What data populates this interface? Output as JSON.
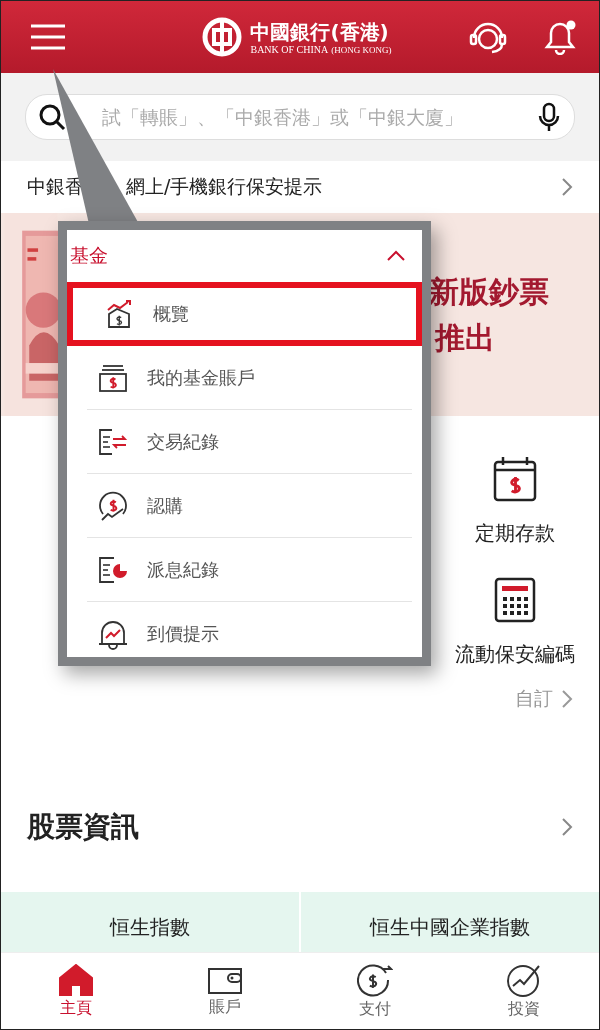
{
  "header": {
    "logo_title": "中國銀行(香港)",
    "logo_subtitle": "BANK OF CHINA",
    "logo_region": "(HONG KONG)",
    "notification_dot": true
  },
  "search": {
    "placeholder": "試「轉賬」、「中銀香港」或「中銀大廈」"
  },
  "notice": {
    "text_before": "中銀香",
    "text_after": "網上/手機銀行保安提示"
  },
  "banner": {
    "kind": "picture",
    "title_line_1": "新版鈔票",
    "title_line_2": "推出"
  },
  "shortcuts": [
    {
      "label": "定期存款"
    },
    {
      "label": "流動保安編碼"
    }
  ],
  "customize": "自訂",
  "stocks": {
    "title": "股票資訊",
    "indices": [
      "恒生指數",
      "恒生中國企業指數"
    ]
  },
  "popup": {
    "title": "基金",
    "expanded": true,
    "items": [
      {
        "label": "概覽",
        "selected": true
      },
      {
        "label": "我的基金賬戶",
        "selected": false
      },
      {
        "label": "交易紀錄",
        "selected": false
      },
      {
        "label": "認購",
        "selected": false
      },
      {
        "label": "派息紀錄",
        "selected": false
      },
      {
        "label": "到價提示",
        "selected": false
      }
    ]
  },
  "tabs": [
    {
      "label": "主頁",
      "selected": true
    },
    {
      "label": "賬戶",
      "selected": false
    },
    {
      "label": "支付",
      "selected": false
    },
    {
      "label": "投資",
      "selected": false
    }
  ]
}
